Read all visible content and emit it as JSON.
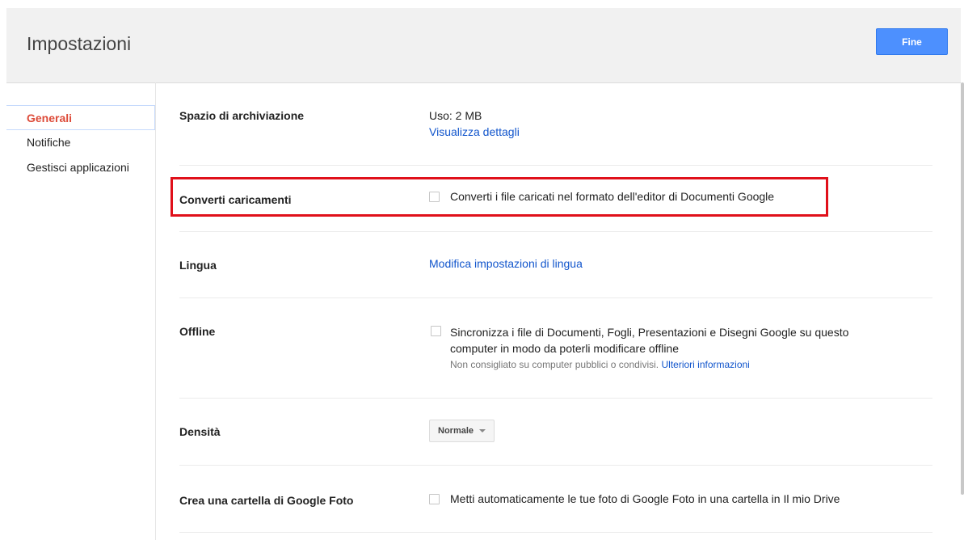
{
  "header": {
    "title": "Impostazioni",
    "done_label": "Fine"
  },
  "sidebar": {
    "items": [
      {
        "label": "Generali",
        "active": true
      },
      {
        "label": "Notifiche",
        "active": false
      },
      {
        "label": "Gestisci applicazioni",
        "active": false
      }
    ]
  },
  "settings": {
    "storage": {
      "label": "Spazio di archiviazione",
      "usage": "Uso: 2 MB",
      "details_link": "Visualizza dettagli"
    },
    "convert": {
      "label": "Converti caricamenti",
      "checkbox_label": "Converti i file caricati nel formato dell'editor di Documenti Google",
      "checked": false
    },
    "language": {
      "label": "Lingua",
      "link": "Modifica impostazioni di lingua"
    },
    "offline": {
      "label": "Offline",
      "checkbox_line1": "Sincronizza i file di Documenti, Fogli, Presentazioni e Disegni Google su questo",
      "checkbox_line2": "computer in modo da poterli modificare offline",
      "note": "Non consigliato su computer pubblici o condivisi.",
      "more_link": "Ulteriori informazioni",
      "checked": false
    },
    "density": {
      "label": "Densità",
      "selected": "Normale"
    },
    "photos": {
      "label": "Crea una cartella di Google Foto",
      "checkbox_label": "Metti automaticamente le tue foto di Google Foto in una cartella in Il mio Drive",
      "checked": false
    }
  },
  "colors": {
    "accent": "#4d90fe",
    "active_nav": "#dd4b39",
    "link": "#1155cc",
    "highlight": "#e0101a"
  }
}
